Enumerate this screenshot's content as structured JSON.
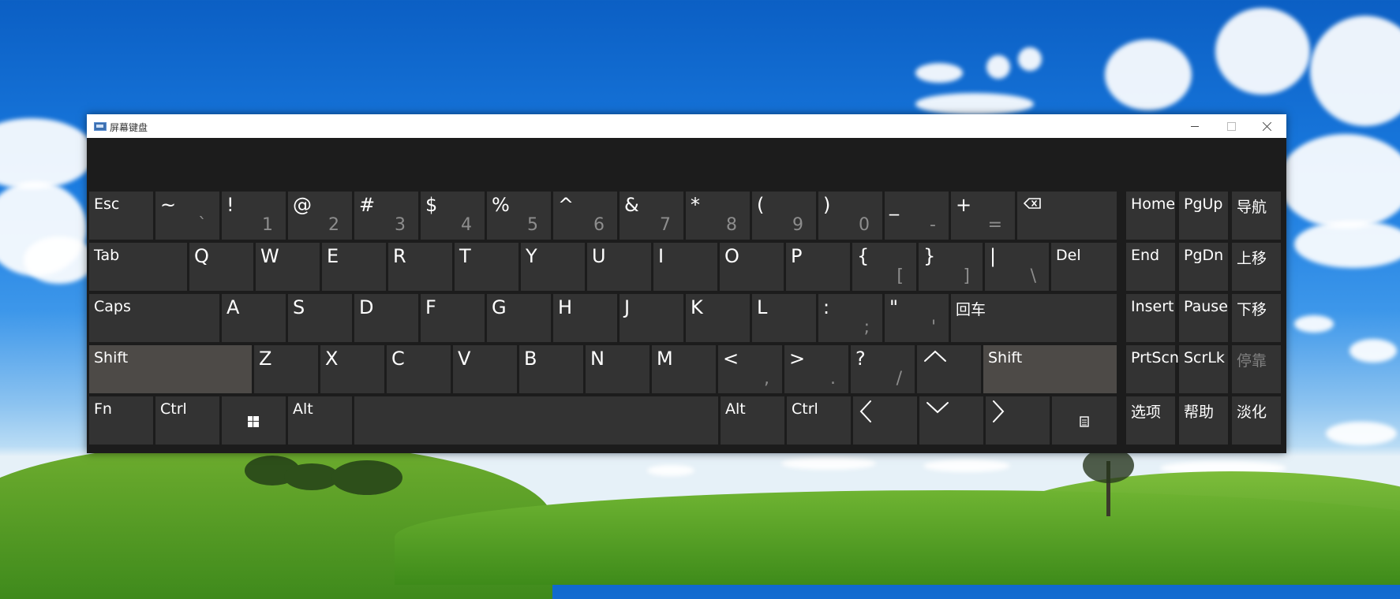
{
  "window": {
    "title": "屏幕键盘"
  },
  "rows": [
    [
      {
        "id": "esc",
        "label": "Esc"
      },
      {
        "id": "tilde",
        "label": "~",
        "sub": "`"
      },
      {
        "id": "1",
        "label": "!",
        "sub": "1"
      },
      {
        "id": "2",
        "label": "@",
        "sub": "2"
      },
      {
        "id": "3",
        "label": "#",
        "sub": "3"
      },
      {
        "id": "4",
        "label": "$",
        "sub": "4"
      },
      {
        "id": "5",
        "label": "%",
        "sub": "5"
      },
      {
        "id": "6",
        "label": "^",
        "sub": "6"
      },
      {
        "id": "7",
        "label": "&",
        "sub": "7"
      },
      {
        "id": "8",
        "label": "*",
        "sub": "8"
      },
      {
        "id": "9",
        "label": "(",
        "sub": "9"
      },
      {
        "id": "0",
        "label": ")",
        "sub": "0"
      },
      {
        "id": "minus",
        "label": "_",
        "sub": "-"
      },
      {
        "id": "equals",
        "label": "+",
        "sub": "="
      },
      {
        "id": "backspace",
        "label": "",
        "icon": "backspace-icon"
      },
      {
        "id": "home",
        "label": "Home"
      },
      {
        "id": "pgup",
        "label": "PgUp"
      },
      {
        "id": "nav",
        "label": "导航"
      }
    ],
    [
      {
        "id": "tab",
        "label": "Tab"
      },
      {
        "id": "q",
        "label": "Q"
      },
      {
        "id": "w",
        "label": "W"
      },
      {
        "id": "e",
        "label": "E"
      },
      {
        "id": "r",
        "label": "R"
      },
      {
        "id": "t",
        "label": "T"
      },
      {
        "id": "y",
        "label": "Y"
      },
      {
        "id": "u",
        "label": "U"
      },
      {
        "id": "i",
        "label": "I"
      },
      {
        "id": "o",
        "label": "O"
      },
      {
        "id": "p",
        "label": "P"
      },
      {
        "id": "lbrace",
        "label": "{",
        "sub": "["
      },
      {
        "id": "rbrace",
        "label": "}",
        "sub": "]"
      },
      {
        "id": "pipe",
        "label": "|",
        "sub": "\\"
      },
      {
        "id": "del",
        "label": "Del"
      },
      {
        "id": "end",
        "label": "End"
      },
      {
        "id": "pgdn",
        "label": "PgDn"
      },
      {
        "id": "moveup",
        "label": "上移"
      }
    ],
    [
      {
        "id": "caps",
        "label": "Caps"
      },
      {
        "id": "a",
        "label": "A"
      },
      {
        "id": "s",
        "label": "S"
      },
      {
        "id": "d",
        "label": "D"
      },
      {
        "id": "f",
        "label": "F"
      },
      {
        "id": "g",
        "label": "G"
      },
      {
        "id": "h",
        "label": "H"
      },
      {
        "id": "j",
        "label": "J"
      },
      {
        "id": "k",
        "label": "K"
      },
      {
        "id": "l",
        "label": "L"
      },
      {
        "id": "colon",
        "label": ":",
        "sub": ";"
      },
      {
        "id": "quote",
        "label": "\"",
        "sub": "'"
      },
      {
        "id": "enter",
        "label": "回车"
      },
      {
        "id": "insert",
        "label": "Insert"
      },
      {
        "id": "pause",
        "label": "Pause"
      },
      {
        "id": "movedown",
        "label": "下移"
      }
    ],
    [
      {
        "id": "lshift",
        "label": "Shift",
        "active": true
      },
      {
        "id": "z",
        "label": "Z"
      },
      {
        "id": "x",
        "label": "X"
      },
      {
        "id": "c",
        "label": "C"
      },
      {
        "id": "v",
        "label": "V"
      },
      {
        "id": "b",
        "label": "B"
      },
      {
        "id": "n",
        "label": "N"
      },
      {
        "id": "m",
        "label": "M"
      },
      {
        "id": "lt",
        "label": "<",
        "sub": ","
      },
      {
        "id": "gt",
        "label": ">",
        "sub": "."
      },
      {
        "id": "question",
        "label": "?",
        "sub": "/"
      },
      {
        "id": "up",
        "label": "",
        "icon": "arrow-up-icon"
      },
      {
        "id": "rshift",
        "label": "Shift",
        "active": true
      },
      {
        "id": "prtscn",
        "label": "PrtScn"
      },
      {
        "id": "scrlk",
        "label": "ScrLk"
      },
      {
        "id": "dock",
        "label": "停靠",
        "disabled": true
      }
    ],
    [
      {
        "id": "fn",
        "label": "Fn"
      },
      {
        "id": "lctrl",
        "label": "Ctrl"
      },
      {
        "id": "win",
        "label": "",
        "icon": "windows-logo-icon"
      },
      {
        "id": "lalt",
        "label": "Alt"
      },
      {
        "id": "space",
        "label": ""
      },
      {
        "id": "ralt",
        "label": "Alt"
      },
      {
        "id": "rctrl",
        "label": "Ctrl"
      },
      {
        "id": "left",
        "label": "",
        "icon": "arrow-left-icon"
      },
      {
        "id": "down",
        "label": "",
        "icon": "arrow-down-icon"
      },
      {
        "id": "right",
        "label": "",
        "icon": "arrow-right-icon"
      },
      {
        "id": "menu",
        "label": "",
        "icon": "context-menu-icon"
      },
      {
        "id": "options",
        "label": "选项"
      },
      {
        "id": "help",
        "label": "帮助"
      },
      {
        "id": "fade",
        "label": "淡化"
      }
    ]
  ]
}
